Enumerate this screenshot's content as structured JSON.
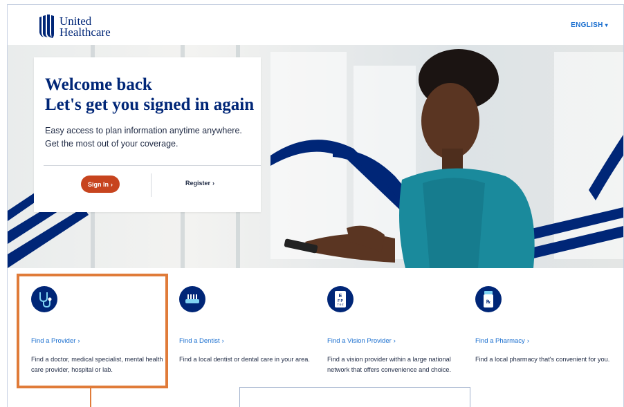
{
  "header": {
    "logo_line1": "United",
    "logo_line2": "Healthcare",
    "language": "ENGLISH"
  },
  "hero": {
    "title_line1": "Welcome back",
    "title_line2": "Let's get you signed in again",
    "desc_line1": "Easy access to plan information anytime anywhere.",
    "desc_line2": "Get the most out of your coverage.",
    "signin_label": "Sign In",
    "register_label": "Register"
  },
  "features": [
    {
      "icon": "stethoscope-icon",
      "link": "Find a Provider",
      "desc": "Find a doctor, medical specialist, mental health care provider, hospital or lab."
    },
    {
      "icon": "toothbrush-icon",
      "link": "Find a Dentist",
      "desc": "Find a local dentist or dental care in your area."
    },
    {
      "icon": "eye-chart-icon",
      "link": "Find a Vision Provider",
      "desc": "Find a vision provider within a large national network that offers convenience and choice."
    },
    {
      "icon": "pill-bottle-icon",
      "link": "Find a Pharmacy",
      "desc": "Find a local pharmacy that's convenient for you."
    }
  ],
  "colors": {
    "brand_navy": "#002677",
    "link_blue": "#196ecf",
    "signin_orange": "#c7441e",
    "highlight_orange": "#e07b39"
  }
}
